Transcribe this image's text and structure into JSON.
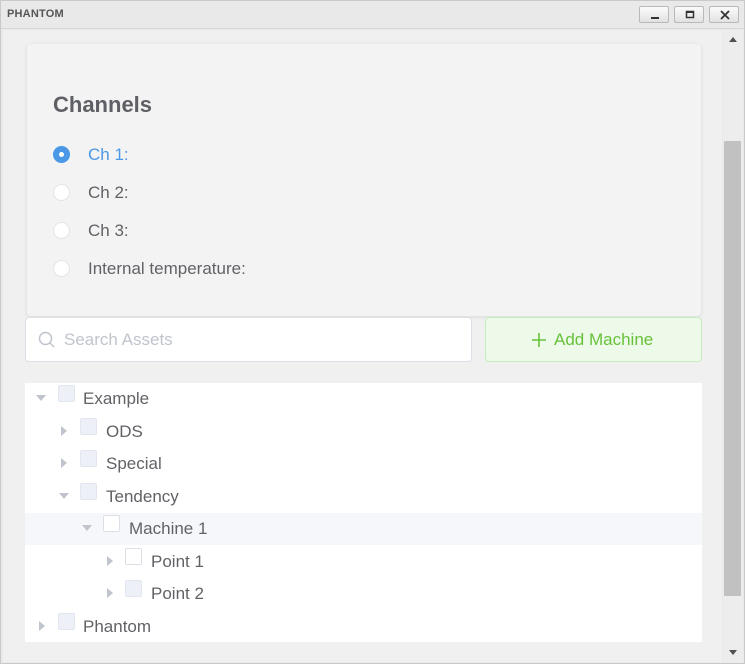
{
  "window": {
    "title": "PHANTOM"
  },
  "channels": {
    "title": "Channels",
    "options": [
      {
        "label": "Ch 1:",
        "selected": true
      },
      {
        "label": "Ch 2:",
        "selected": false
      },
      {
        "label": "Ch 3:",
        "selected": false
      },
      {
        "label": "Internal temperature:",
        "selected": false
      }
    ]
  },
  "search": {
    "placeholder": "Search Assets"
  },
  "add_machine": {
    "label": "Add Machine"
  },
  "tree": {
    "nodes": [
      {
        "label": "Example",
        "level": 0,
        "expanded": true
      },
      {
        "label": "ODS",
        "level": 1,
        "expanded": false
      },
      {
        "label": "Special",
        "level": 1,
        "expanded": false
      },
      {
        "label": "Tendency",
        "level": 1,
        "expanded": true
      },
      {
        "label": "Machine 1",
        "level": 2,
        "expanded": true,
        "highlighted": true
      },
      {
        "label": "Point 1",
        "level": 3,
        "expanded": false
      },
      {
        "label": "Point 2",
        "level": 3,
        "expanded": false
      },
      {
        "label": "Phantom",
        "level": 0,
        "expanded": false
      }
    ]
  },
  "colors": {
    "accent": "#4a98e6",
    "success": "#67c23a",
    "text": "#606266"
  }
}
